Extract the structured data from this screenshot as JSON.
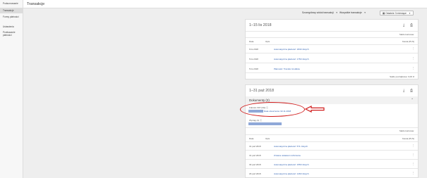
{
  "sidebar": {
    "items": [
      {
        "label": "Podsumowanie",
        "active": false
      },
      {
        "label": "Transakcje",
        "active": true
      },
      {
        "label": "Formy płatności",
        "active": false
      },
      {
        "label": "Ustawienia",
        "active": false
      },
      {
        "label": "Przekazanie płatności",
        "active": false
      }
    ]
  },
  "header": {
    "title": "Transakcje"
  },
  "filters": {
    "type": "Szczegółowy widok transakcji",
    "scope": "Wszystkie transakcje",
    "date": "Ostatnie 3 miesiące"
  },
  "period1": {
    "title": "1–15 lis 2018",
    "total_label": "Saldo końcowe:",
    "columns": [
      "Data",
      "Opis",
      "Kwota (PLN)"
    ],
    "rows": [
      {
        "date": "6 lis 2018",
        "desc": "Automatyczna płatność: 1840 złotych"
      },
      {
        "date": "5 lis 2018",
        "desc": "Automatyczna płatność: 1750 złotych"
      },
      {
        "date": "5 lis 2018",
        "desc": "Płatności: Transfer środków"
      }
    ],
    "opening_balance": "Saldo początkowe: 0,00 zł"
  },
  "period2": {
    "title": "1–31 paź 2018",
    "documents_label": "Dokumenty (2)",
    "invoice_label": "Faktura VAT (UE) ⓘ",
    "invoice_link": "Data utworzenia: 02.11.2018",
    "other_label": "Wyciąg (1) ⓘ",
    "total_label": "Saldo końcowe:",
    "columns": [
      "Data",
      "Opis",
      "Kwota (PLN)"
    ],
    "rows": [
      {
        "date": "31 paź 2018",
        "desc": "Automatyczna płatność: 571 złotych"
      },
      {
        "date": "31 paź 2018",
        "desc": "Zmiana ustawień rozliczenia"
      },
      {
        "date": "30 paź 2018",
        "desc": "Automatyczna płatność: 1550 złotych"
      },
      {
        "date": "29 paź 2018",
        "desc": "Automatyczna płatność: 1460 złotych"
      }
    ]
  },
  "icons": {
    "download": "⤓",
    "print": "⎙",
    "row": "⋮",
    "collapse": "⌃",
    "arrow": "⟸"
  }
}
